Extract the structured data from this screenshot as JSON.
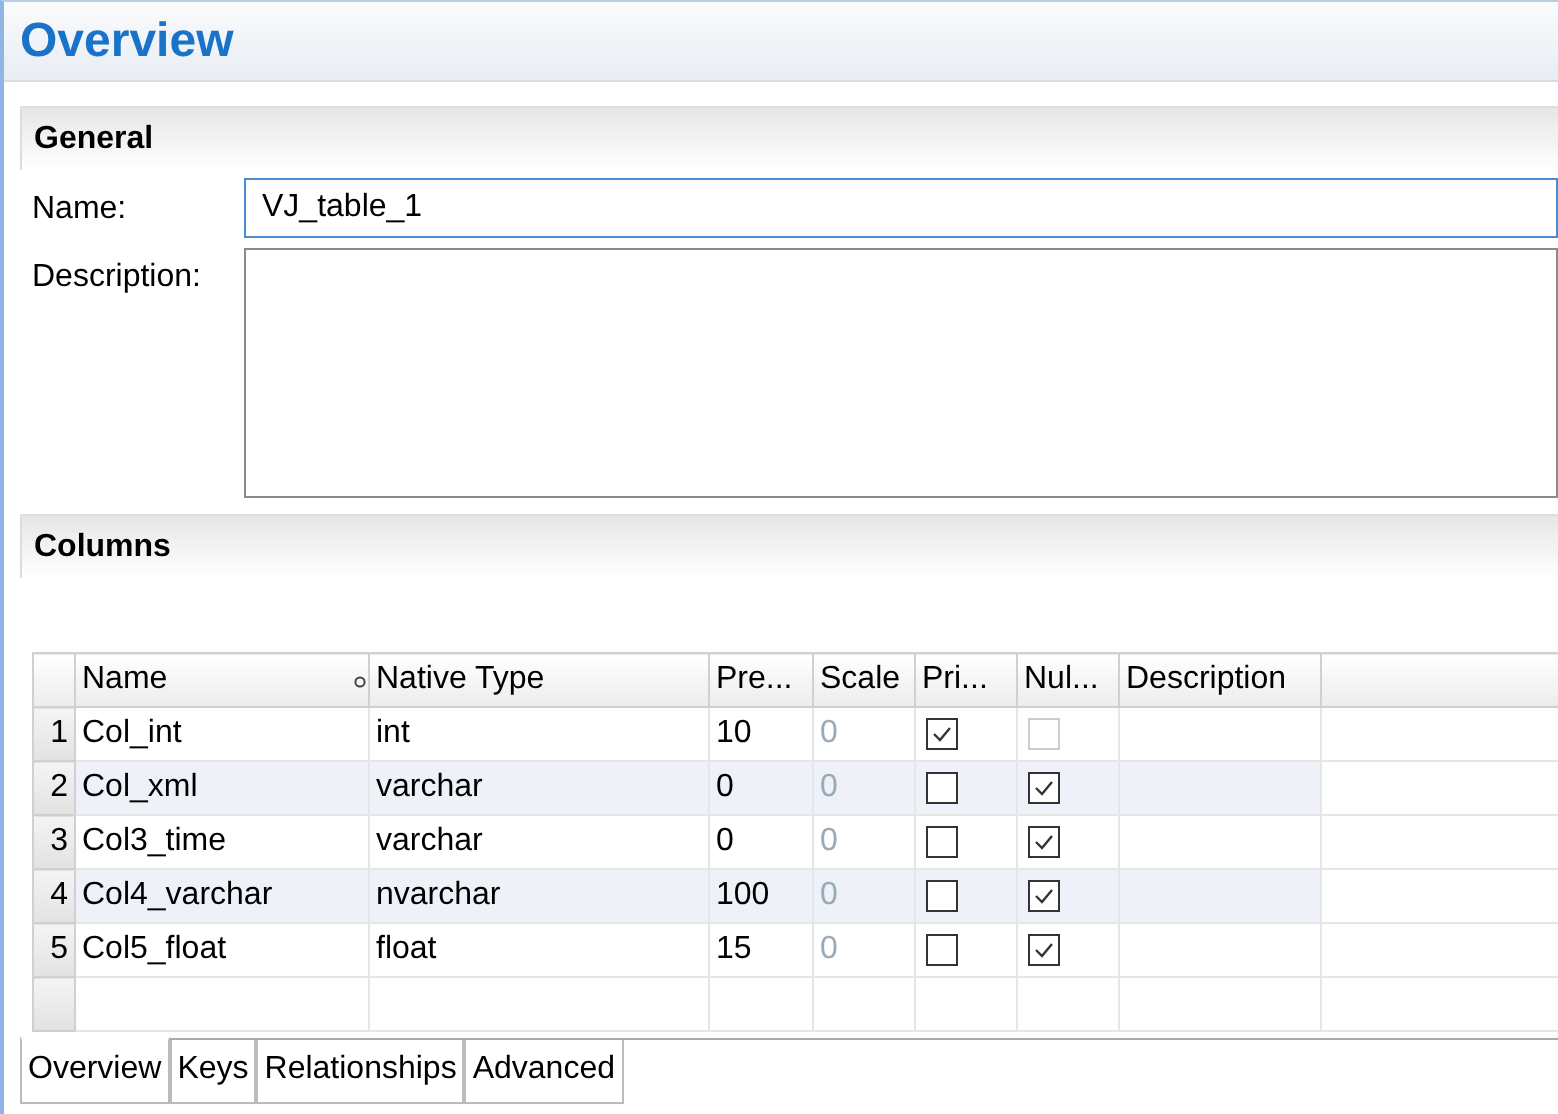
{
  "title": "Overview",
  "general": {
    "heading": "General",
    "name_label": "Name:",
    "name_value": "VJ_table_1",
    "description_label": "Description:"
  },
  "columns_section": {
    "heading": "Columns"
  },
  "table": {
    "columns": [
      {
        "label": "Name",
        "sorted": true
      },
      {
        "label": "Native Type",
        "sorted": false
      },
      {
        "label": "Pre...",
        "sorted": false
      },
      {
        "label": "Scale",
        "sorted": false
      },
      {
        "label": "Pri...",
        "sorted": false
      },
      {
        "label": "Nul...",
        "sorted": false
      },
      {
        "label": "Description",
        "sorted": false
      }
    ],
    "rows": [
      {
        "number": "1",
        "name": "Col_int",
        "native_type": "int",
        "precision": "10",
        "scale": "0",
        "primary_key": {
          "checked": true,
          "disabled": false
        },
        "nullable": {
          "checked": false,
          "disabled": true
        }
      },
      {
        "number": "2",
        "name": "Col_xml",
        "native_type": "varchar",
        "precision": "0",
        "scale": "0",
        "primary_key": {
          "checked": false,
          "disabled": false
        },
        "nullable": {
          "checked": true,
          "disabled": false
        }
      },
      {
        "number": "3",
        "name": "Col3_time",
        "native_type": "varchar",
        "precision": "0",
        "scale": "0",
        "primary_key": {
          "checked": false,
          "disabled": false
        },
        "nullable": {
          "checked": true,
          "disabled": false
        }
      },
      {
        "number": "4",
        "name": "Col4_varchar",
        "native_type": "nvarchar",
        "precision": "100",
        "scale": "0",
        "primary_key": {
          "checked": false,
          "disabled": false
        },
        "nullable": {
          "checked": true,
          "disabled": false
        }
      },
      {
        "number": "5",
        "name": "Col5_float",
        "native_type": "float",
        "precision": "15",
        "scale": "0",
        "primary_key": {
          "checked": false,
          "disabled": false
        },
        "nullable": {
          "checked": true,
          "disabled": false
        }
      }
    ]
  },
  "tabs": [
    {
      "label": "Overview",
      "selected": true
    },
    {
      "label": "Keys",
      "selected": false
    },
    {
      "label": "Relationships",
      "selected": false
    },
    {
      "label": "Advanced",
      "selected": false
    }
  ]
}
